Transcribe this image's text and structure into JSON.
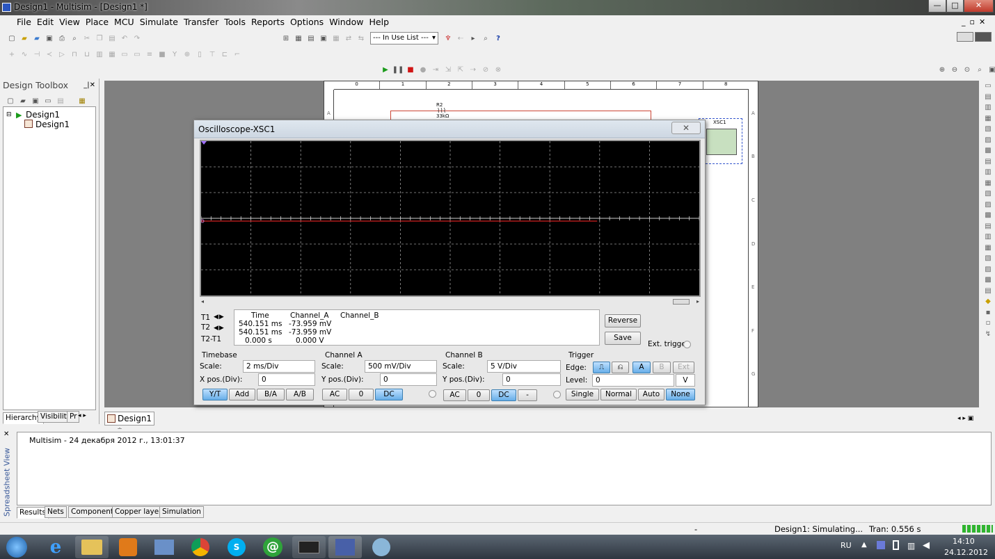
{
  "window": {
    "title": "Design1 - Multisim - [Design1 *]",
    "min": "—",
    "max": "□",
    "close": "✕"
  },
  "menu": [
    "File",
    "Edit",
    "View",
    "Place",
    "MCU",
    "Simulate",
    "Transfer",
    "Tools",
    "Reports",
    "Options",
    "Window",
    "Help"
  ],
  "toolbar": {
    "in_use_list": "--- In Use List ---",
    "help_glyph": "?"
  },
  "toolbox": {
    "title": "Design Toolbox",
    "tree_root": "Design1",
    "tree_child": "Design1",
    "tabs": [
      "Hierarchy",
      "Visibility",
      "Pr"
    ]
  },
  "schematic": {
    "col_labels": [
      "0",
      "1",
      "2",
      "3",
      "4",
      "5",
      "6",
      "7",
      "8"
    ],
    "row_labels": [
      "A",
      "B",
      "C",
      "D",
      "E",
      "F",
      "G"
    ],
    "resistor": {
      "ref": "R2",
      "value": "33kΩ"
    },
    "scope_ref": "XSC1",
    "doc_tab": "Design1 *"
  },
  "oscilloscope": {
    "title": "Oscilloscope-XSC1",
    "readout": {
      "headers": [
        "Time",
        "Channel_A",
        "Channel_B"
      ],
      "rows": [
        {
          "label": "T1",
          "time": "540.151 ms",
          "a": "-73.959 mV",
          "b": ""
        },
        {
          "label": "T2",
          "time": "540.151 ms",
          "a": "-73.959 mV",
          "b": ""
        },
        {
          "label": "T2-T1",
          "time": "0.000 s",
          "a": "0.000 V",
          "b": ""
        }
      ]
    },
    "reverse": "Reverse",
    "save": "Save",
    "ext_trigger": "Ext. trigger",
    "timebase": {
      "title": "Timebase",
      "scale_label": "Scale:",
      "scale": "2 ms/Div",
      "xpos_label": "X pos.(Div):",
      "xpos": "0",
      "buttons": [
        "Y/T",
        "Add",
        "B/A",
        "A/B"
      ]
    },
    "channel_a": {
      "title": "Channel A",
      "scale_label": "Scale:",
      "scale": "500 mV/Div",
      "ypos_label": "Y pos.(Div):",
      "ypos": "0",
      "buttons": [
        "AC",
        "0",
        "DC"
      ]
    },
    "channel_b": {
      "title": "Channel B",
      "scale_label": "Scale:",
      "scale": "5  V/Div",
      "ypos_label": "Y pos.(Div):",
      "ypos": "0",
      "buttons": [
        "AC",
        "0",
        "DC",
        "-"
      ]
    },
    "trigger": {
      "title": "Trigger",
      "edge_label": "Edge:",
      "sources": [
        "A",
        "B",
        "Ext"
      ],
      "level_label": "Level:",
      "level": "0",
      "unit": "V",
      "modes": [
        "Single",
        "Normal",
        "Auto",
        "None"
      ]
    }
  },
  "spreadsheet": {
    "side_label": "Spreadsheet View",
    "message": "Multisim  -  24 декабря 2012 г., 13:01:37",
    "tabs": [
      "Results",
      "Nets",
      "Components",
      "Copper layers",
      "Simulation"
    ]
  },
  "status": {
    "dash": "-",
    "sim": "Design1: Simulating...",
    "tran": "Tran: 0.556 s"
  },
  "taskbar": {
    "lang": "RU",
    "time": "14:10",
    "date": "24.12.2012"
  },
  "colors": {
    "scope_bg": "#000000",
    "trace_a": "#d02020",
    "grid": "#9a9a9a",
    "toggle_on": "#67aee8"
  }
}
